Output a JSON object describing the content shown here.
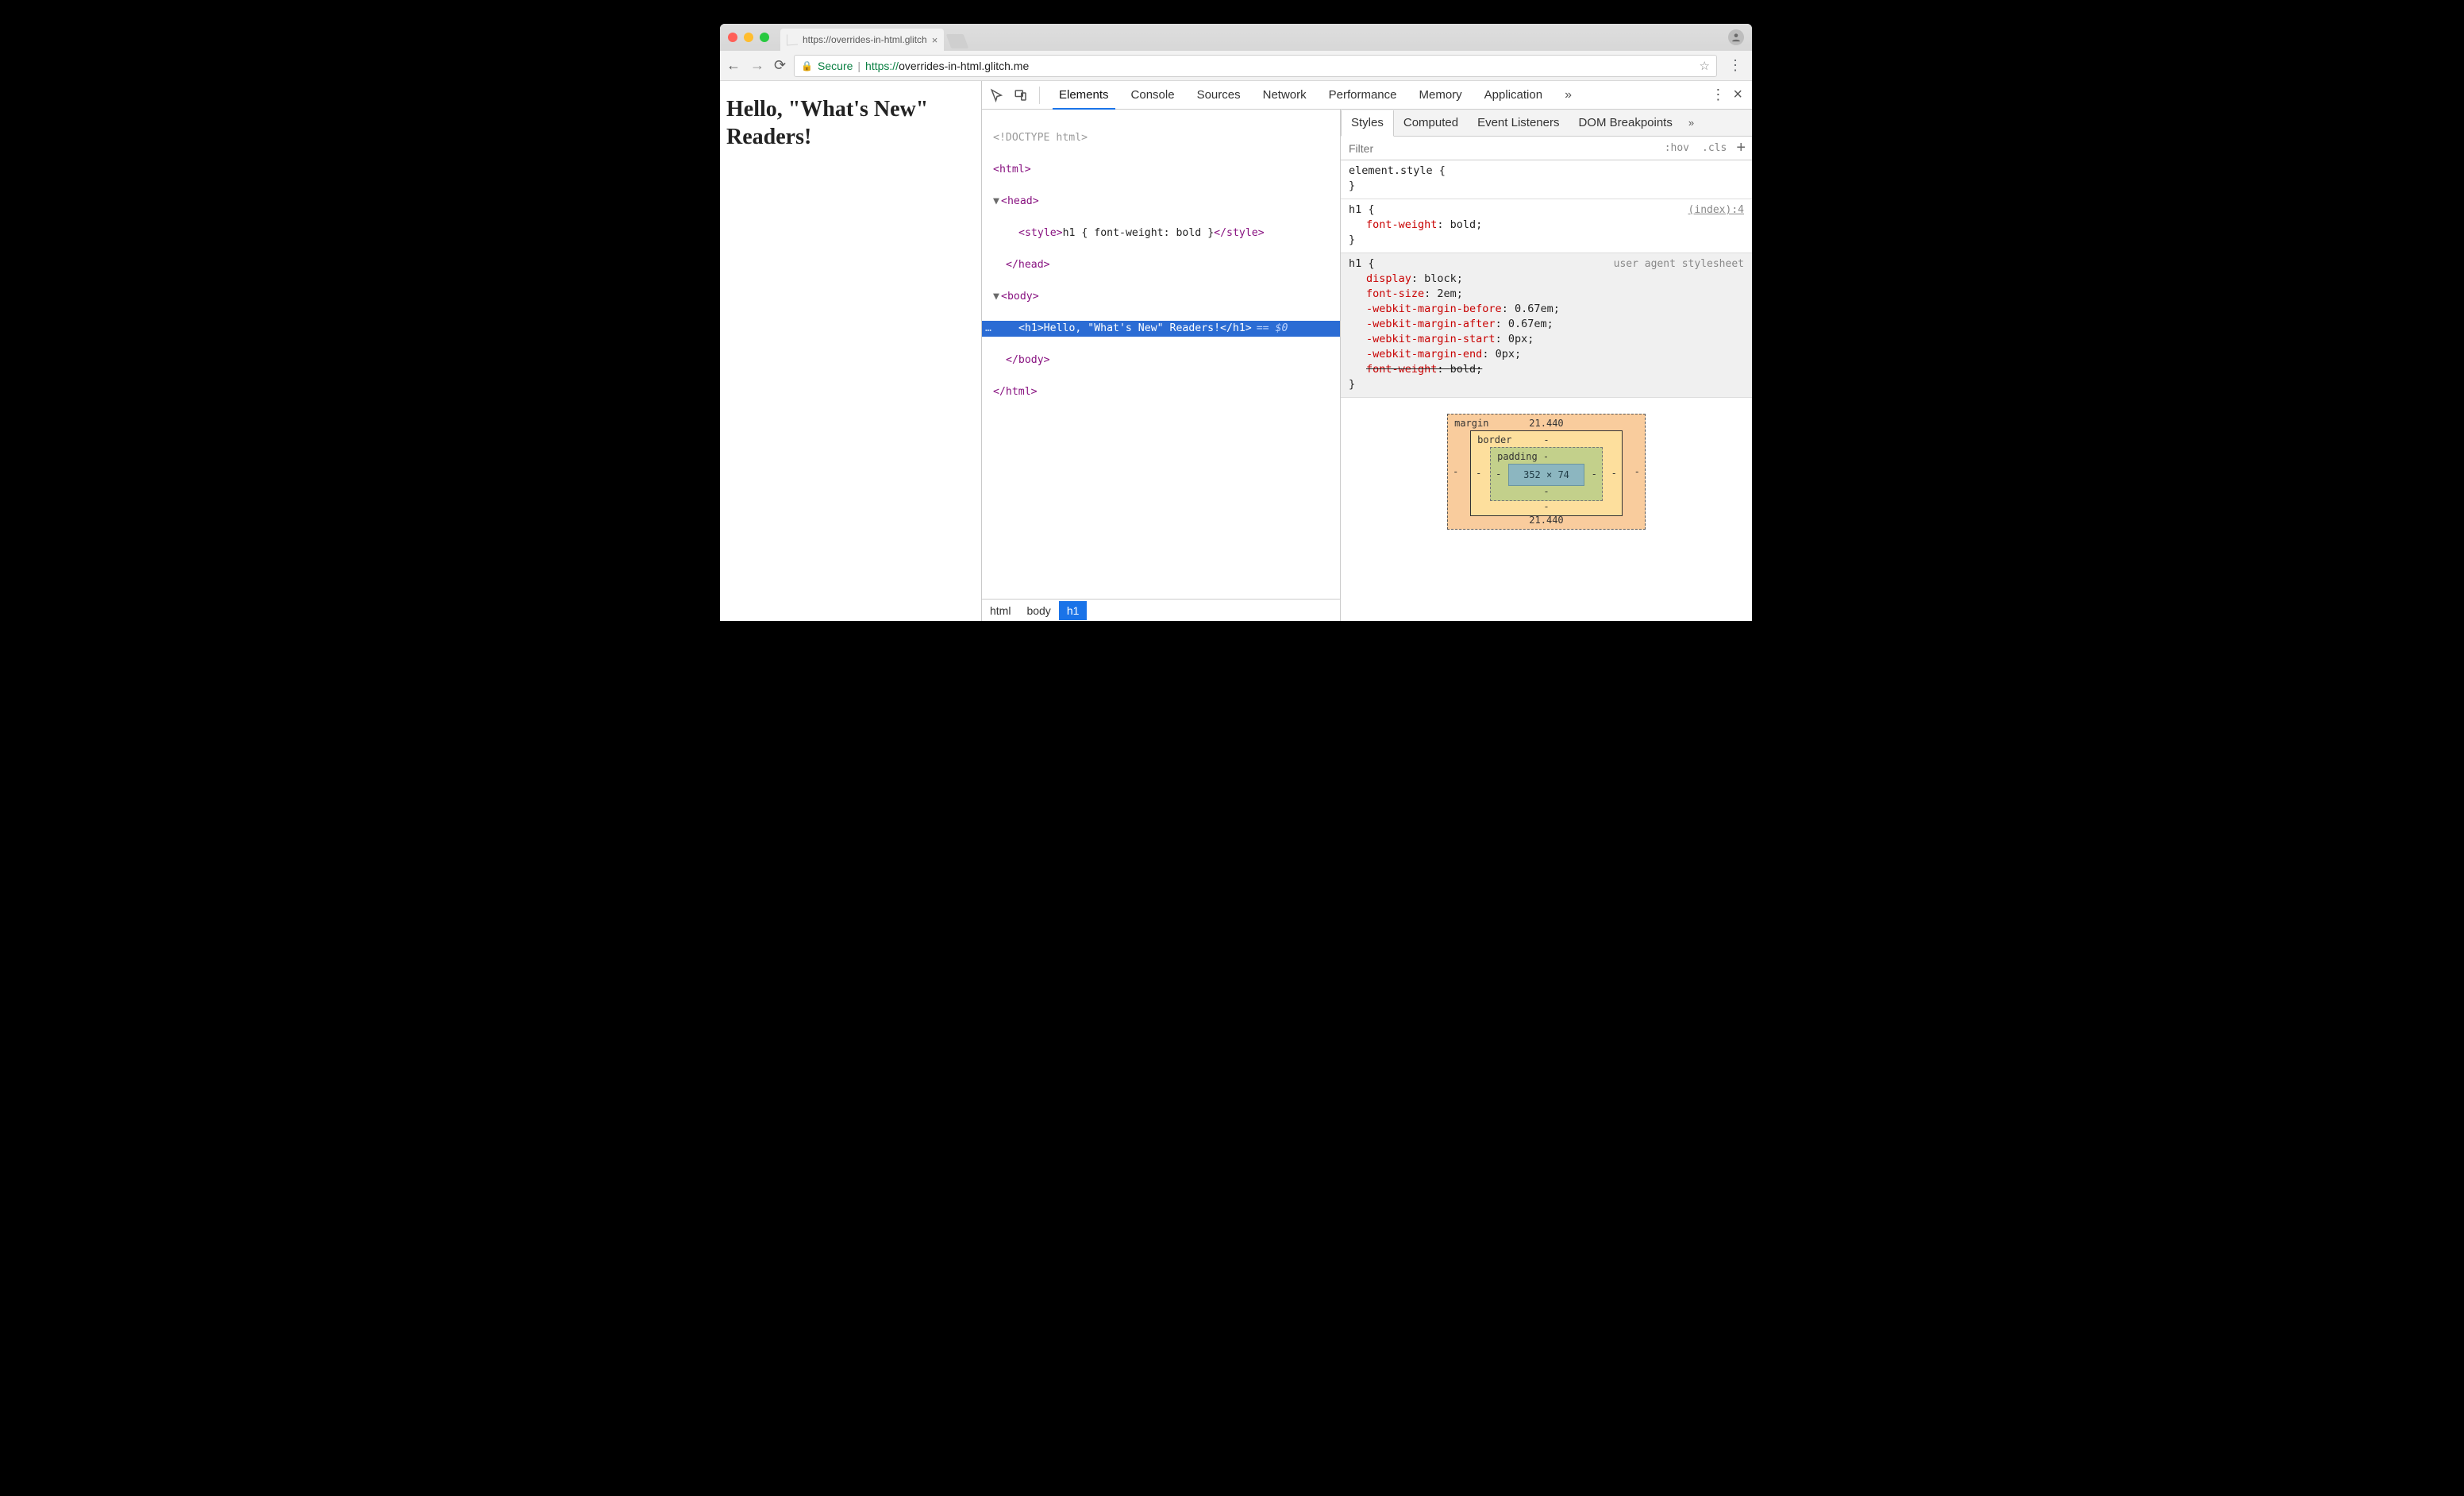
{
  "window": {
    "tab_title": "https://overrides-in-html.glitch",
    "tab_close": "×"
  },
  "omnibar": {
    "secure_label": "Secure",
    "scheme": "https://",
    "host": "overrides-in-html.glitch.me",
    "path": ""
  },
  "page": {
    "h1": "Hello, \"What's New\" Readers!"
  },
  "devtools": {
    "tabs": [
      "Elements",
      "Console",
      "Sources",
      "Network",
      "Performance",
      "Memory",
      "Application"
    ],
    "more_glyph": "»",
    "kebab_glyph": "⋮",
    "close_glyph": "×"
  },
  "dom": {
    "doctype": "<!DOCTYPE html>",
    "html_open": "<html>",
    "head_open": "<head>",
    "style_open": "<style>",
    "style_text": "h1 { font-weight: bold }",
    "style_close": "</style>",
    "head_close": "</head>",
    "body_open": "<body>",
    "h1_open": "<h1>",
    "h1_text": "Hello, \"What's New\" Readers!",
    "h1_close": "</h1>",
    "eqvar": "== $0",
    "body_close": "</body>",
    "html_close": "</html>",
    "ellipsis": "…"
  },
  "breadcrumbs": [
    "html",
    "body",
    "h1"
  ],
  "styles_tabs": [
    "Styles",
    "Computed",
    "Event Listeners",
    "DOM Breakpoints"
  ],
  "filter": {
    "placeholder": "Filter",
    "hov": ":hov",
    "cls": ".cls"
  },
  "rules": {
    "elstyle_sel": "element.style {",
    "close_brace": "}",
    "r1_sel": "h1 {",
    "r1_src": "(index):4",
    "r1_decls": [
      {
        "prop": "font-weight",
        "val": "bold;"
      }
    ],
    "r2_sel": "h1 {",
    "r2_src": "user agent stylesheet",
    "r2_decls": [
      {
        "prop": "display",
        "val": "block;"
      },
      {
        "prop": "font-size",
        "val": "2em;"
      },
      {
        "prop": "-webkit-margin-before",
        "val": "0.67em;"
      },
      {
        "prop": "-webkit-margin-after",
        "val": "0.67em;"
      },
      {
        "prop": "-webkit-margin-start",
        "val": "0px;"
      },
      {
        "prop": "-webkit-margin-end",
        "val": "0px;"
      },
      {
        "prop": "font-weight",
        "val": "bold;",
        "strike": true
      }
    ]
  },
  "boxmodel": {
    "margin_label": "margin",
    "margin_top": "21.440",
    "margin_bottom": "21.440",
    "margin_side": "-",
    "border_label": "border",
    "border_dash": "-",
    "padding_label": "padding -",
    "padding_dash": "-",
    "content": "352 × 74"
  }
}
